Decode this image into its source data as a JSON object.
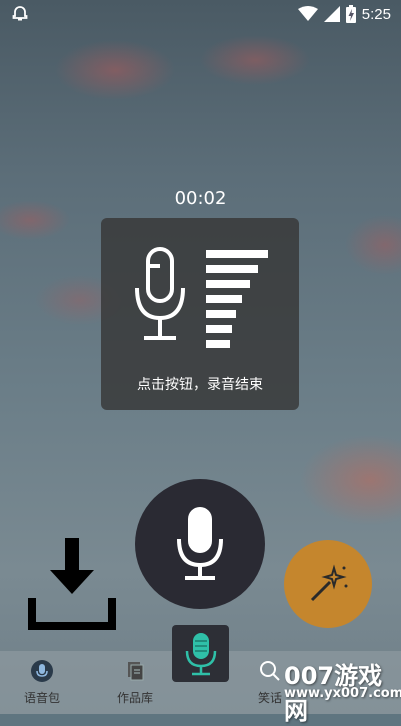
{
  "status_bar": {
    "time": "5:25",
    "icons": [
      "notification-icon",
      "wifi-icon",
      "signal-icon",
      "battery-charging-icon"
    ]
  },
  "recording": {
    "timer": "00:02",
    "hint": "点击按钮，录音结束"
  },
  "bottom_nav": {
    "tabs": [
      {
        "label": "语音包",
        "icon": "mic-circle-icon"
      },
      {
        "label": "作品库",
        "icon": "document-copy-icon"
      },
      {
        "label": "",
        "icon": "mic-icon"
      },
      {
        "label": "笑话",
        "icon": "search-icon"
      }
    ]
  },
  "watermark": {
    "brand": "007游戏网",
    "url": "www.yx007.com"
  },
  "colors": {
    "magic_button": "#c5862d",
    "record_button": "#2a2a33",
    "center_mic_accent": "#2fc0a8"
  }
}
